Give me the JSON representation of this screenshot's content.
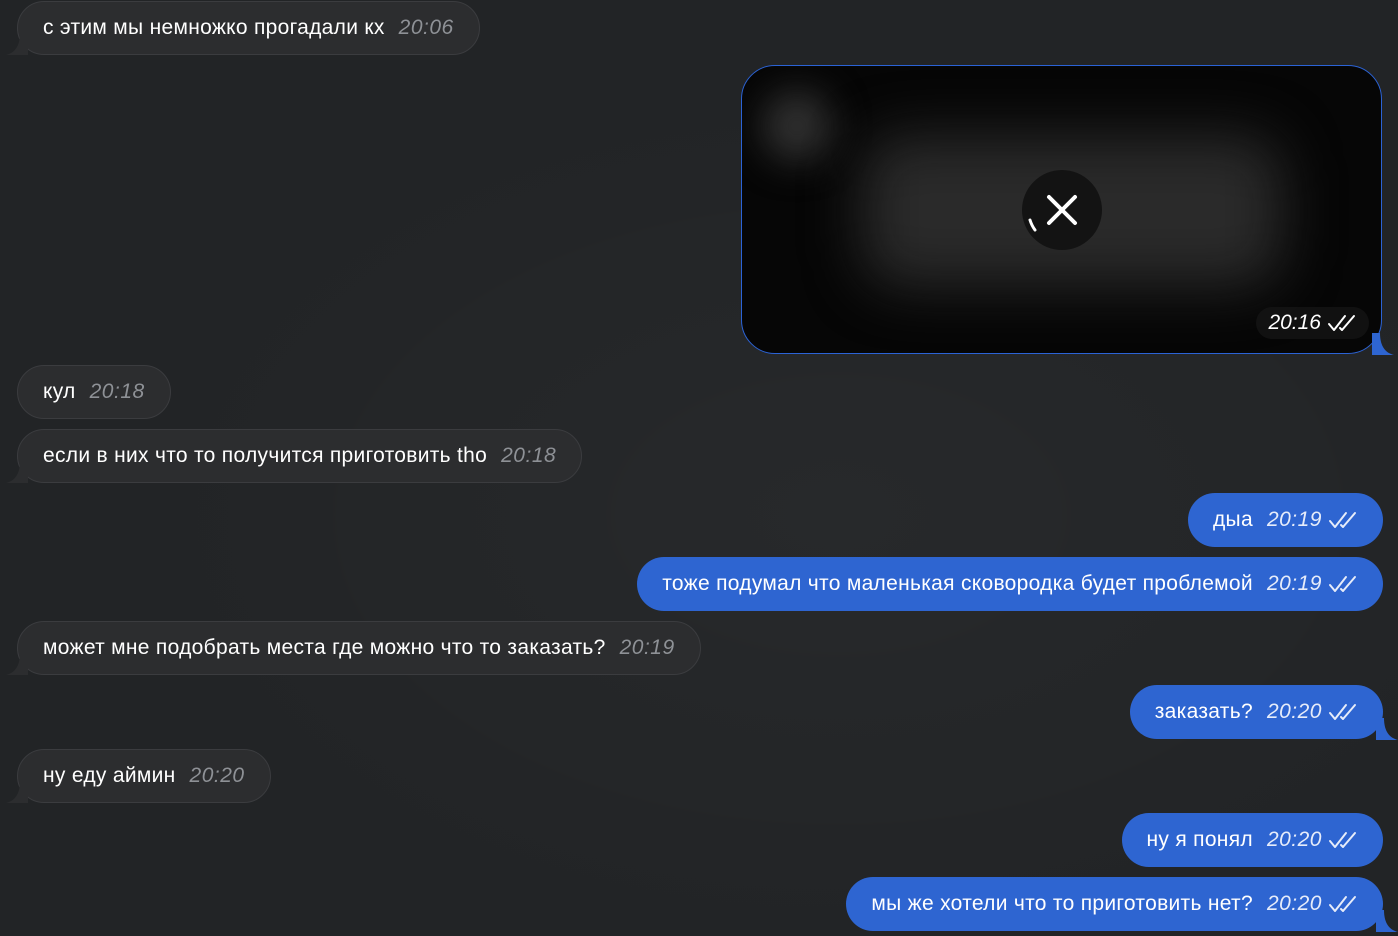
{
  "messages": [
    {
      "direction": "in",
      "text": "с этим мы немножко прогадали кх",
      "time": "20:06"
    },
    {
      "direction": "out",
      "type": "media",
      "time": "20:16",
      "status": "read"
    },
    {
      "direction": "in",
      "text": "кул",
      "time": "20:18"
    },
    {
      "direction": "in",
      "text": "если в них что то получится приготовить tho",
      "time": "20:18"
    },
    {
      "direction": "out",
      "text": "дыа",
      "time": "20:19",
      "status": "read"
    },
    {
      "direction": "out",
      "text": "тоже подумал что маленькая сковородка будет проблемой",
      "time": "20:19",
      "status": "read"
    },
    {
      "direction": "in",
      "text": "может мне подобрать места где можно что то заказать?",
      "time": "20:19"
    },
    {
      "direction": "out",
      "text": "заказать?",
      "time": "20:20",
      "status": "read"
    },
    {
      "direction": "in",
      "text": "ну еду аймин",
      "time": "20:20"
    },
    {
      "direction": "out",
      "text": "ну я понял",
      "time": "20:20",
      "status": "read"
    },
    {
      "direction": "out",
      "text": "мы же хотели что то приготовить нет?",
      "time": "20:20",
      "status": "read"
    }
  ],
  "icons": {
    "media_cancel": "close-icon",
    "read_receipt": "double-check-icon"
  },
  "colors": {
    "background": "#222426",
    "incoming_bubble": "#2c2d2f",
    "outgoing_bubble": "#2e65d1",
    "timestamp_incoming": "#8e9196"
  }
}
